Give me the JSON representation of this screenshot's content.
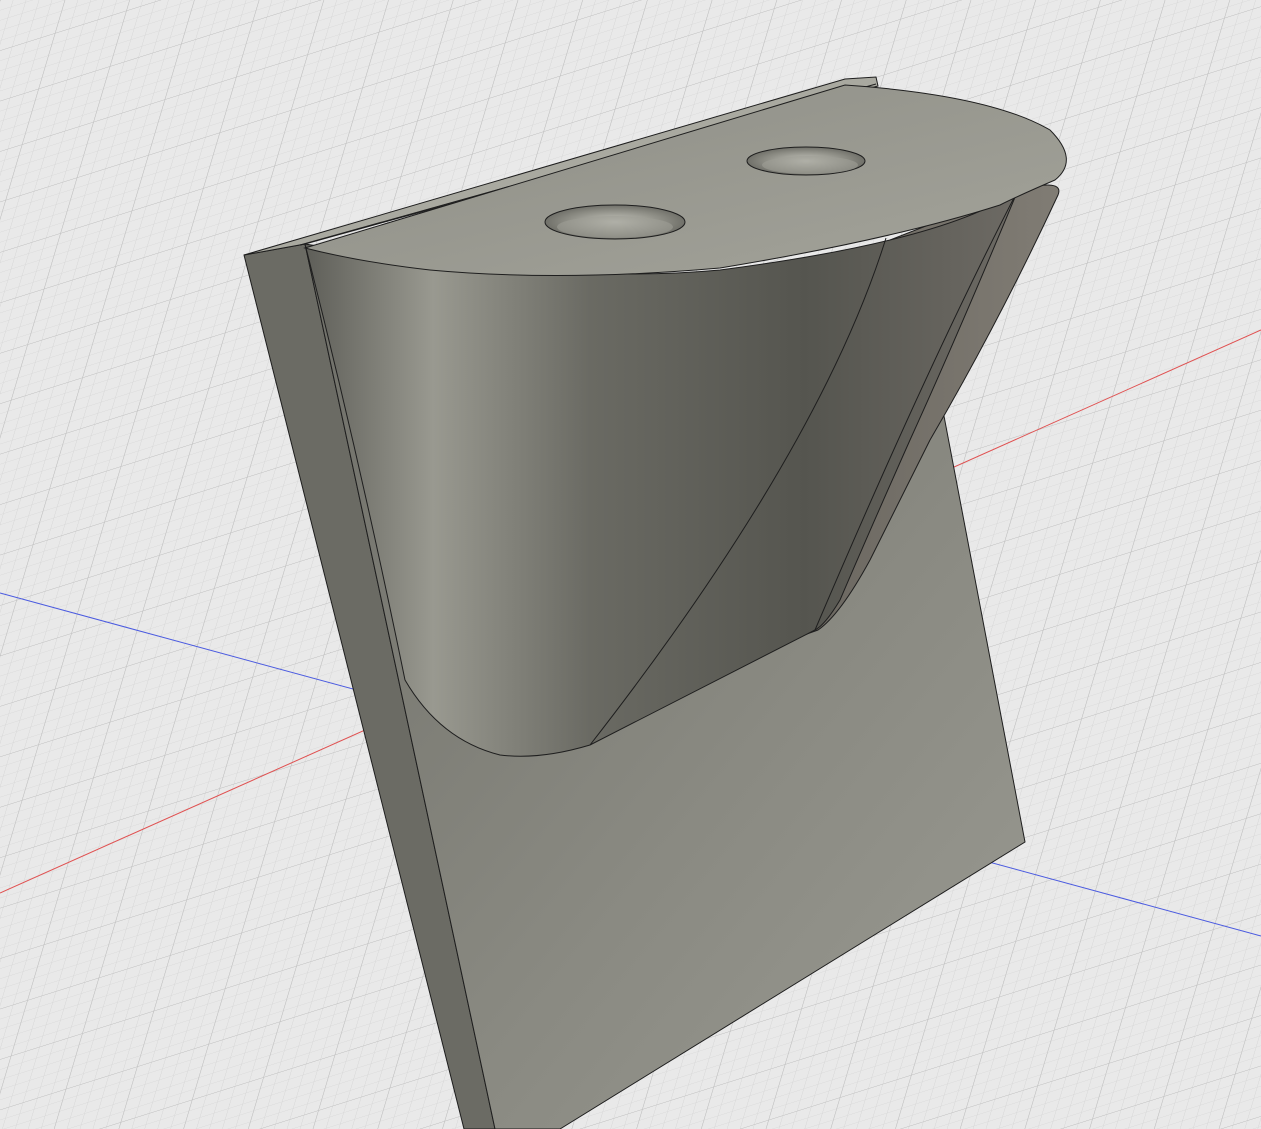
{
  "viewport": {
    "background_color": "#e9e9e9",
    "grid_minor_color": "#d4d4d4",
    "grid_major_color": "#bdbdbd",
    "axis_x_color": "#e05050",
    "axis_z_color": "#4a5ae0"
  },
  "model": {
    "body_color": "#8a8a80",
    "top_face_color": "#9c9c92",
    "edge_color": "#1e1e1e",
    "hole_count": 2
  }
}
